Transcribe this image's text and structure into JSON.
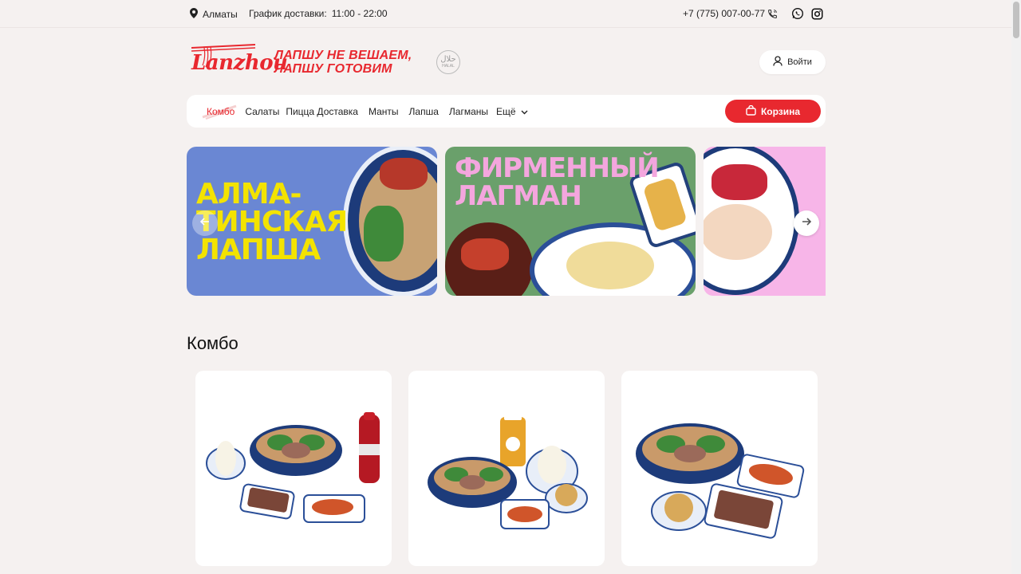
{
  "topbar": {
    "city": "Алматы",
    "schedule_label": "График доставки:",
    "schedule_hours": "11:00 - 22:00",
    "phone": "+7 (775) 007-00-77"
  },
  "header": {
    "logo_text": "Lanzhou",
    "slogan_line1": "ЛАПШУ НЕ ВЕШАЕМ,",
    "slogan_line2": "ЛАПШУ ГОТОВИМ",
    "halal_text": "HALAL",
    "login_label": "Войти"
  },
  "nav": {
    "items": [
      {
        "label": "Комбо"
      },
      {
        "label": "Салаты"
      },
      {
        "label": "Пицца Доставка"
      },
      {
        "label": "Манты"
      },
      {
        "label": "Лапша"
      },
      {
        "label": "Лагманы"
      }
    ],
    "more_label": "Ещё",
    "cart_label": "Корзина"
  },
  "banners": [
    {
      "title_line1": "АЛМА-",
      "title_line2": "ТИНСКАЯ",
      "title_line3": "ЛАПША"
    },
    {
      "title_line1": "ФИРМЕННЫЙ",
      "title_line2": "ЛАГМАН"
    },
    {
      "title_line1": ""
    }
  ],
  "section": {
    "title": "Комбо"
  },
  "colors": {
    "accent": "#e8282f",
    "background": "#f5f1f0"
  }
}
